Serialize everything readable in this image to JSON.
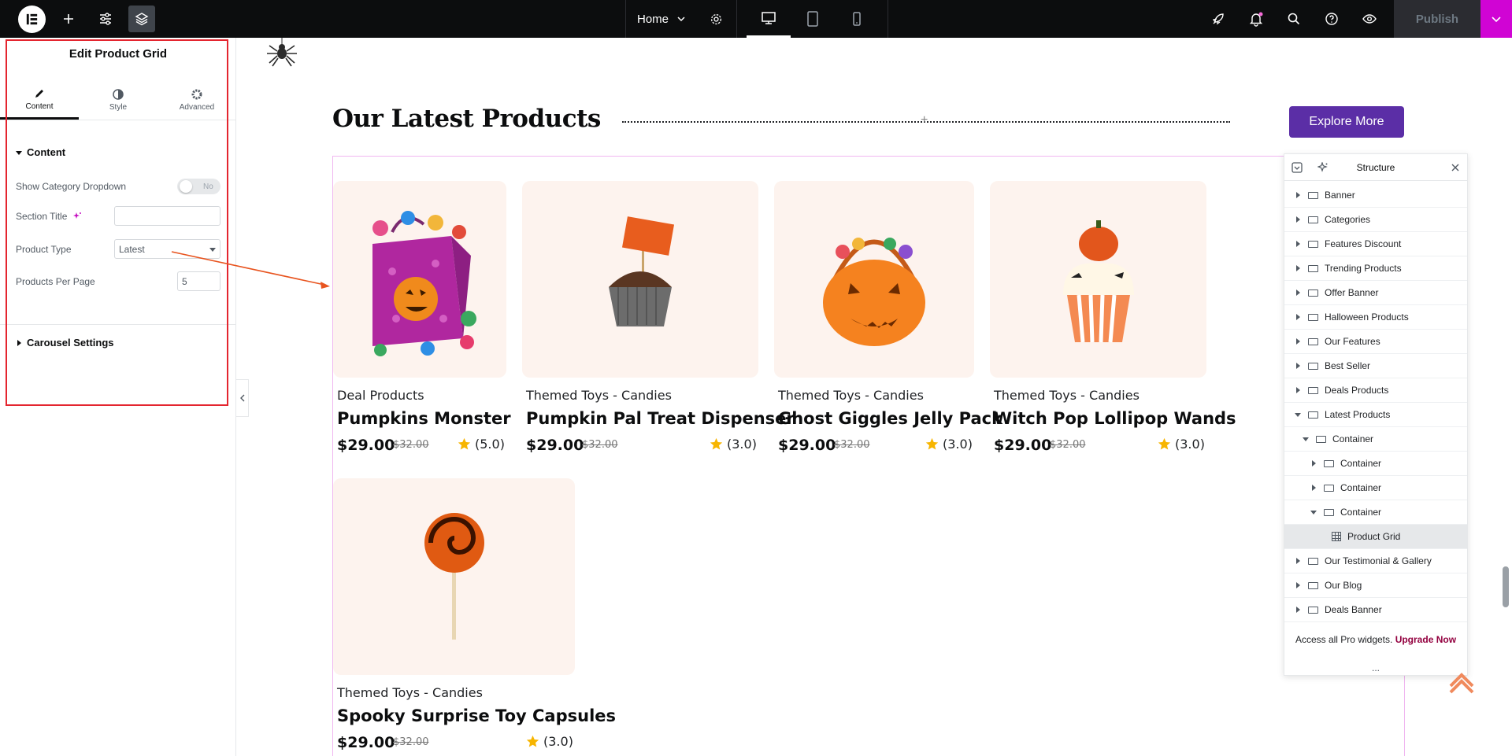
{
  "topbar": {
    "page_name": "Home",
    "publish_label": "Publish",
    "icons": {
      "logo": "elementor-logo-icon",
      "add": "plus-icon",
      "site_settings": "sliders-icon",
      "structure": "layers-icon",
      "page_settings": "gear-icon",
      "desktop": "desktop-icon",
      "tablet": "tablet-icon",
      "mobile": "mobile-icon",
      "launch": "rocket-icon",
      "notifications": "bell-icon",
      "finder": "search-icon",
      "help": "help-icon",
      "preview": "eye-icon"
    }
  },
  "panel": {
    "title": "Edit Product Grid",
    "tabs": [
      {
        "label": "Content",
        "icon": "pencil-icon"
      },
      {
        "label": "Style",
        "icon": "half-circle-icon"
      },
      {
        "label": "Advanced",
        "icon": "gear-icon"
      }
    ],
    "section_content": "Content",
    "controls": {
      "show_category_dropdown": {
        "label": "Show Category Dropdown",
        "value": "No"
      },
      "section_title": {
        "label": "Section Title",
        "value": ""
      },
      "product_type": {
        "label": "Product Type",
        "value": "Latest"
      },
      "products_per_page": {
        "label": "Products Per Page",
        "value": "5"
      }
    },
    "section_carousel": "Carousel Settings",
    "highlight_color": "#e4252f"
  },
  "canvas": {
    "section_title": "Our Latest Products",
    "explore_label": "Explore More",
    "accent_color": "#5b2ea6",
    "products": [
      {
        "category": "Deal Products",
        "name": "Pumpkins Monster",
        "price": "$29.00",
        "old_price": "$32.00",
        "rating": "(5.0)",
        "image": "candy-bag"
      },
      {
        "category": "Themed Toys - Candies",
        "name": "Pumpkin Pal Treat Dispenser",
        "price": "$29.00",
        "old_price": "$32.00",
        "rating": "(3.0)",
        "image": "chocolate-cupcake"
      },
      {
        "category": "Themed Toys - Candies",
        "name": "Ghost Giggles Jelly Pack",
        "price": "$29.00",
        "old_price": "$32.00",
        "rating": "(3.0)",
        "image": "pumpkin-basket"
      },
      {
        "category": "Themed Toys - Candies",
        "name": "Witch Pop Lollipop Wands",
        "price": "$29.00",
        "old_price": "$32.00",
        "rating": "(3.0)",
        "image": "pumpkin-cupcake"
      },
      {
        "category": "Themed Toys - Candies",
        "name": "Spooky Surprise Toy Capsules",
        "price": "$29.00",
        "old_price": "$32.00",
        "rating": "(3.0)",
        "image": "lollipop"
      }
    ]
  },
  "structure": {
    "title": "Structure",
    "items": [
      {
        "label": "Banner",
        "state": "collapsed"
      },
      {
        "label": "Categories",
        "state": "collapsed"
      },
      {
        "label": "Features Discount",
        "state": "collapsed"
      },
      {
        "label": "Trending Products",
        "state": "collapsed"
      },
      {
        "label": "Offer Banner",
        "state": "collapsed"
      },
      {
        "label": "Halloween Products",
        "state": "collapsed"
      },
      {
        "label": "Our Features",
        "state": "collapsed"
      },
      {
        "label": "Best Seller",
        "state": "collapsed"
      },
      {
        "label": "Deals Products",
        "state": "collapsed"
      },
      {
        "label": "Latest Products",
        "state": "expanded"
      },
      {
        "label": "Container",
        "state": "expanded"
      },
      {
        "label": "Container",
        "state": "collapsed"
      },
      {
        "label": "Container",
        "state": "collapsed"
      },
      {
        "label": "Container",
        "state": "expanded"
      },
      {
        "label": "Product Grid",
        "state": "selected"
      },
      {
        "label": "Our Testimonial & Gallery",
        "state": "collapsed"
      },
      {
        "label": "Our Blog",
        "state": "collapsed"
      },
      {
        "label": "Deals Banner",
        "state": "collapsed"
      }
    ],
    "promo_text": "Access all Pro widgets.",
    "promo_link": "Upgrade Now",
    "more": "..."
  }
}
